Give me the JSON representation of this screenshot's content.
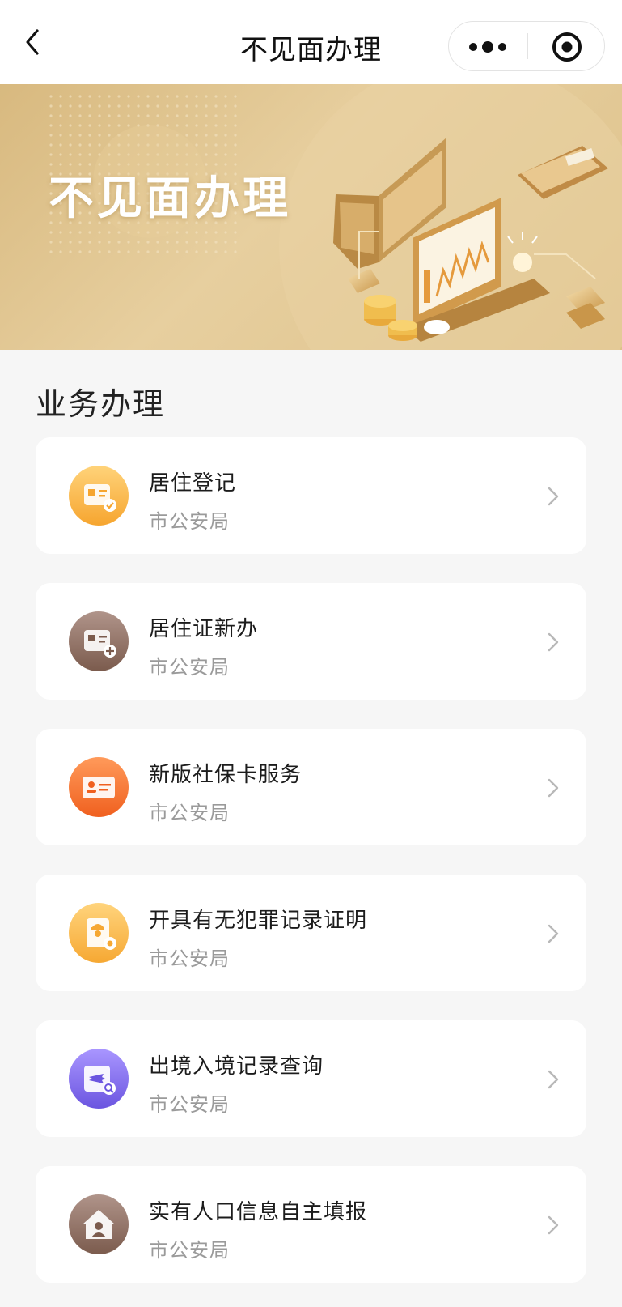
{
  "navbar": {
    "title": "不见面办理",
    "back_icon": "chevron-left-icon",
    "more_icon": "more-dots-icon",
    "close_icon": "target-close-icon"
  },
  "banner": {
    "title": "不见面办理"
  },
  "section": {
    "title": "业务办理"
  },
  "services": [
    {
      "name": "居住登记",
      "dept": "市公安局",
      "icon": "id-card-check-icon",
      "color": "#f7ad3a"
    },
    {
      "name": "居住证新办",
      "dept": "市公安局",
      "icon": "id-card-add-icon",
      "color": "#8a6a5b"
    },
    {
      "name": "新版社保卡服务",
      "dept": "市公安局",
      "icon": "social-card-icon",
      "color": "#f26b2e"
    },
    {
      "name": "开具有无犯罪记录证明",
      "dept": "市公安局",
      "icon": "police-certificate-icon",
      "color": "#f7b33f"
    },
    {
      "name": "出境入境记录查询",
      "dept": "市公安局",
      "icon": "flight-search-icon",
      "color": "#7b67e8"
    },
    {
      "name": "实有人口信息自主填报",
      "dept": "市公安局",
      "icon": "house-person-icon",
      "color": "#8a6a5b"
    }
  ]
}
